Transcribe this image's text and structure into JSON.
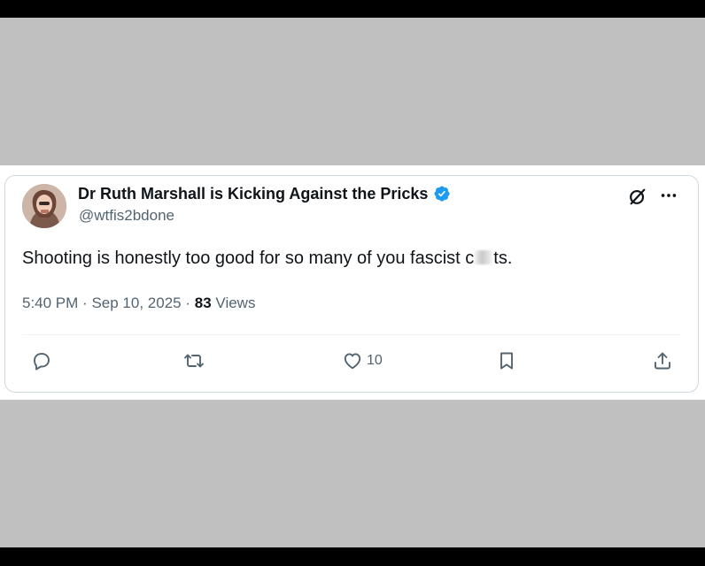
{
  "tweet": {
    "display_name": "Dr Ruth Marshall is Kicking Against the Pricks",
    "handle": "@wtfis2bdone",
    "text_before": "Shooting is honestly too good for so many of you fascist c",
    "text_after": "ts.",
    "time": "5:40 PM",
    "separator": "·",
    "date": "Sep 10, 2025",
    "views_count": "83",
    "views_label": "Views",
    "like_count": "10"
  },
  "icons": {
    "verified": "verified-badge-icon",
    "grok": "grok-icon",
    "more": "more-options-icon",
    "reply": "reply-icon",
    "retweet": "retweet-icon",
    "like": "heart-icon",
    "bookmark": "bookmark-icon",
    "share": "share-icon"
  },
  "colors": {
    "text_primary": "#0f1419",
    "text_secondary": "#536471",
    "verified_blue": "#1d9bf0",
    "border": "#cfd9de",
    "letterbox_gray": "#c0c0c0"
  }
}
